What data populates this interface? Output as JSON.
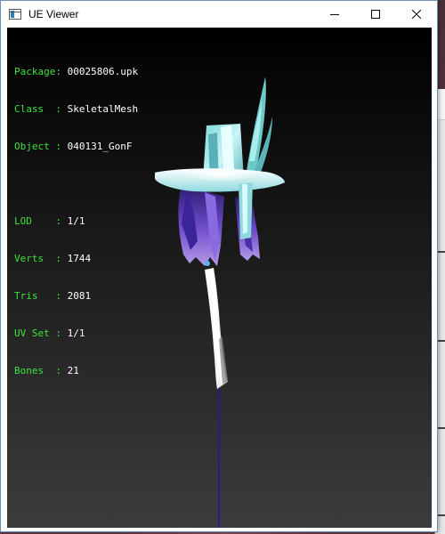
{
  "window": {
    "title": "UE Viewer"
  },
  "info": {
    "asset": [
      {
        "key": "Package",
        "sep": ": ",
        "value": "00025806.upk"
      },
      {
        "key": "Class  ",
        "sep": ": ",
        "value": "SkeletalMesh"
      },
      {
        "key": "Object ",
        "sep": ": ",
        "value": "040131_GonF"
      }
    ],
    "stats": [
      {
        "key": "LOD    ",
        "sep": ": ",
        "value": "1/1"
      },
      {
        "key": "Verts  ",
        "sep": ": ",
        "value": "1744"
      },
      {
        "key": "Tris   ",
        "sep": ": ",
        "value": "2081"
      },
      {
        "key": "UV Set ",
        "sep": ": ",
        "value": "1/1"
      },
      {
        "key": "Bones  ",
        "sep": ": ",
        "value": "21"
      }
    ]
  },
  "colors": {
    "label": "#3de23d",
    "value": "#ffffff",
    "axis": "#1a1aa8"
  }
}
